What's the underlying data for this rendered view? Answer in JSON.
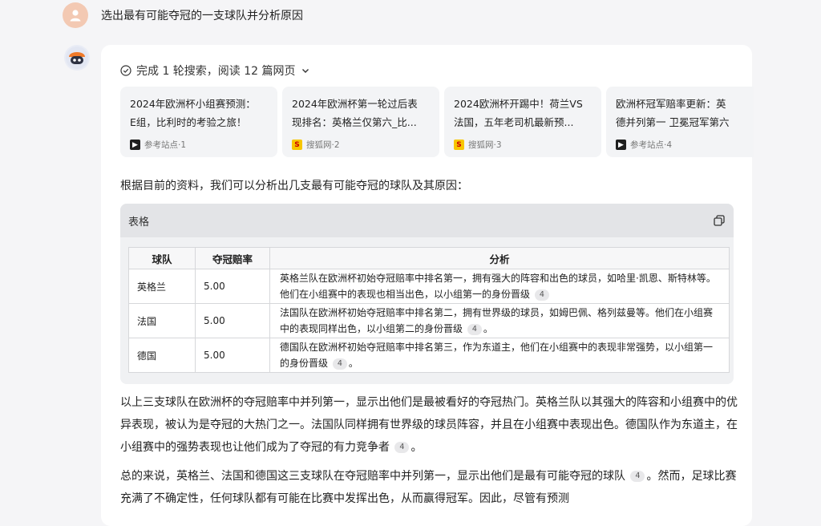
{
  "user_message": "选出最有可能夺冠的一支球队并分析原因",
  "search_summary": "完成 1 轮搜索，阅读 12 篇网页",
  "references": [
    {
      "title": "2024年欧洲杯小组赛预测：\nE组，比利时的考验之旅！",
      "source": "参考站点·1",
      "icon": "ref-site-icon"
    },
    {
      "title": "2024年欧洲杯第一轮过后表\n现排名：英格兰仅第六_比...",
      "source": "搜狐网·2",
      "icon": "sohu-icon"
    },
    {
      "title": "2024欧洲杯开踢中！荷兰VS\n法国，五年老司机最新预...",
      "source": "搜狐网·3",
      "icon": "sohu-icon"
    },
    {
      "title": "欧洲杯冠军赔率更新：英\n德并列第一 卫冕冠军第六",
      "source": "参考站点·4",
      "icon": "ref-site-icon"
    }
  ],
  "intro": "根据目前的资料，我们可以分析出几支最有可能夺冠的球队及其原因：",
  "table": {
    "label": "表格",
    "headers": [
      "球队",
      "夺冠赔率",
      "分析"
    ],
    "rows": [
      {
        "team": "英格兰",
        "odds": "5.00",
        "analysis": "英格兰队在欧洲杯初始夺冠赔率中排名第一，拥有强大的阵容和出色的球员，如哈里·凯恩、斯特林等。他们在小组赛中的表现也相当出色，以小组第一的身份晋级",
        "cite": "4"
      },
      {
        "team": "法国",
        "odds": "5.00",
        "analysis": "法国队在欧洲杯初始夺冠赔率中排名第二，拥有世界级的球员，如姆巴佩、格列兹曼等。他们在小组赛中的表现同样出色，以小组第二的身份晋级",
        "cite": "4"
      },
      {
        "team": "德国",
        "odds": "5.00",
        "analysis": "德国队在欧洲杯初始夺冠赔率中排名第三，作为东道主，他们在小组赛中的表现非常强势，以小组第一的身份晋级",
        "cite": "4"
      }
    ]
  },
  "paragraph1": "以上三支球队在欧洲杯的夺冠赔率中并列第一，显示出他们是最被看好的夺冠热门。英格兰队以其强大的阵容和小组赛中的优异表现，被认为是夺冠的大热门之一。法国队同样拥有世界级的球员阵容，并且在小组赛中表现出色。德国队作为东道主，在小组赛中的强势表现也让他们成为了夺冠的有力竞争者",
  "paragraph1_cite": "4",
  "paragraph2": "总的来说，英格兰、法国和德国这三支球队在夺冠赔率中并列第一，显示出他们是最有可能夺冠的球队",
  "paragraph2_cite": "4",
  "paragraph2_cont": "。然而，足球比赛充满了不确定性，任何球队都有可能在比赛中发挥出色，从而赢得冠军。因此，尽管有预测"
}
